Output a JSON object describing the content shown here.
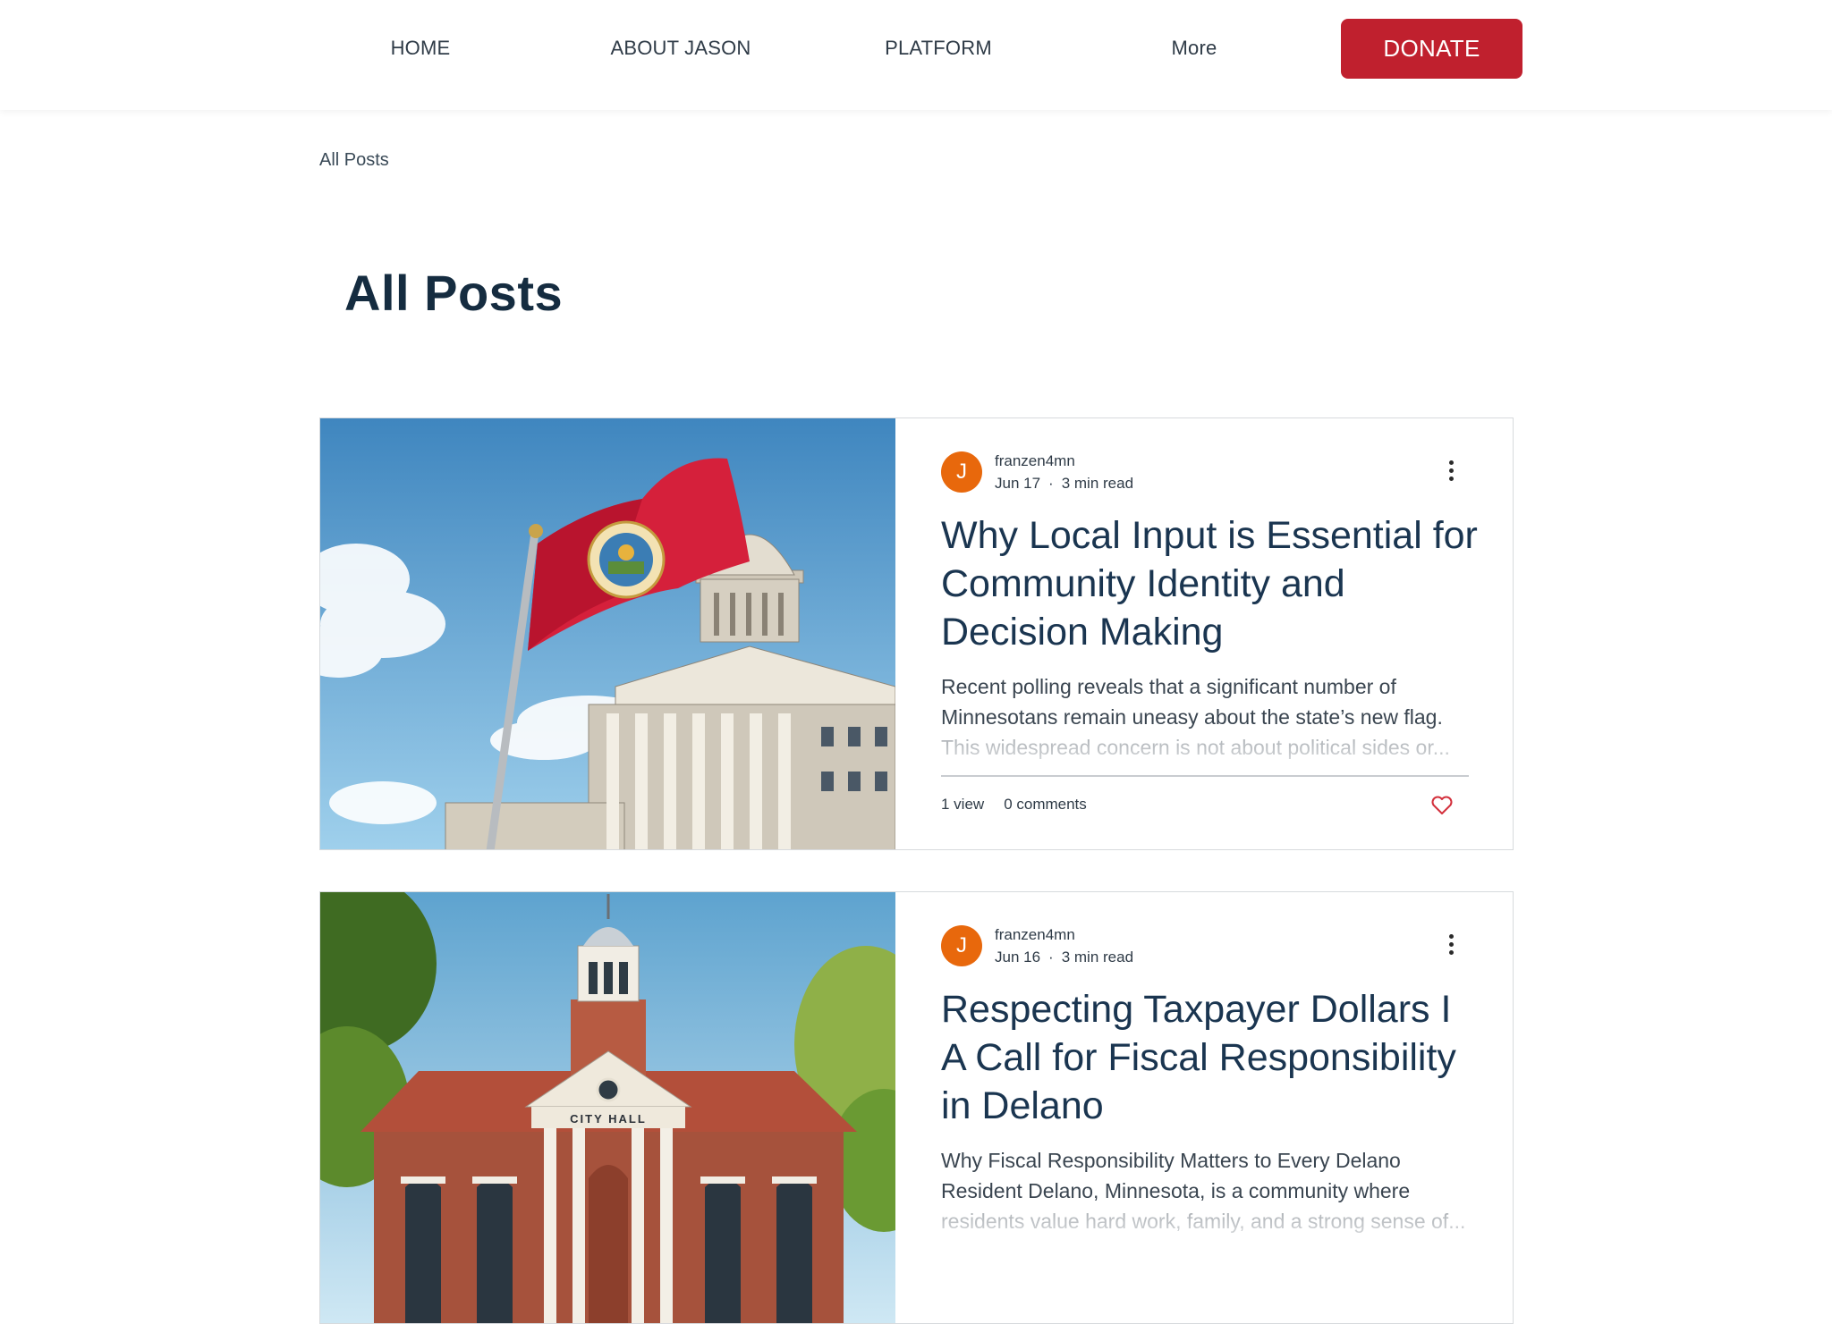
{
  "nav": {
    "items": [
      {
        "label": "HOME"
      },
      {
        "label": "ABOUT JASON"
      },
      {
        "label": "PLATFORM"
      },
      {
        "label": "More"
      }
    ],
    "donate_label": "DONATE"
  },
  "breadcrumb": "All Posts",
  "page_title": "All Posts",
  "posts": [
    {
      "avatar_initial": "J",
      "author": "franzen4mn",
      "date": "Jun 17",
      "separator": "·",
      "read_time": "3 min read",
      "title": "Why Local Input is Essential for Community Identity and Decision Making",
      "excerpt": "Recent polling reveals that a significant number of Minnesotans remain uneasy about the state’s new flag. This widespread concern is not about political sides or...",
      "views": "1 view",
      "comments": "0 comments",
      "image_icon": "flag-capitol-image"
    },
    {
      "avatar_initial": "J",
      "author": "franzen4mn",
      "date": "Jun 16",
      "separator": "·",
      "read_time": "3 min read",
      "title": "Respecting Taxpayer Dollars I A Call for Fiscal Responsibility in Delano",
      "excerpt": "Why Fiscal Responsibility Matters to Every Delano Resident Delano, Minnesota, is a community where residents value hard work, family, and a strong sense of...",
      "image_icon": "city-hall-image",
      "image_sign": "CITY HALL"
    }
  ],
  "colors": {
    "accent": "#c0202e",
    "avatar": "#e8680c",
    "title_text": "#1a3550",
    "heart": "#d3303c"
  }
}
